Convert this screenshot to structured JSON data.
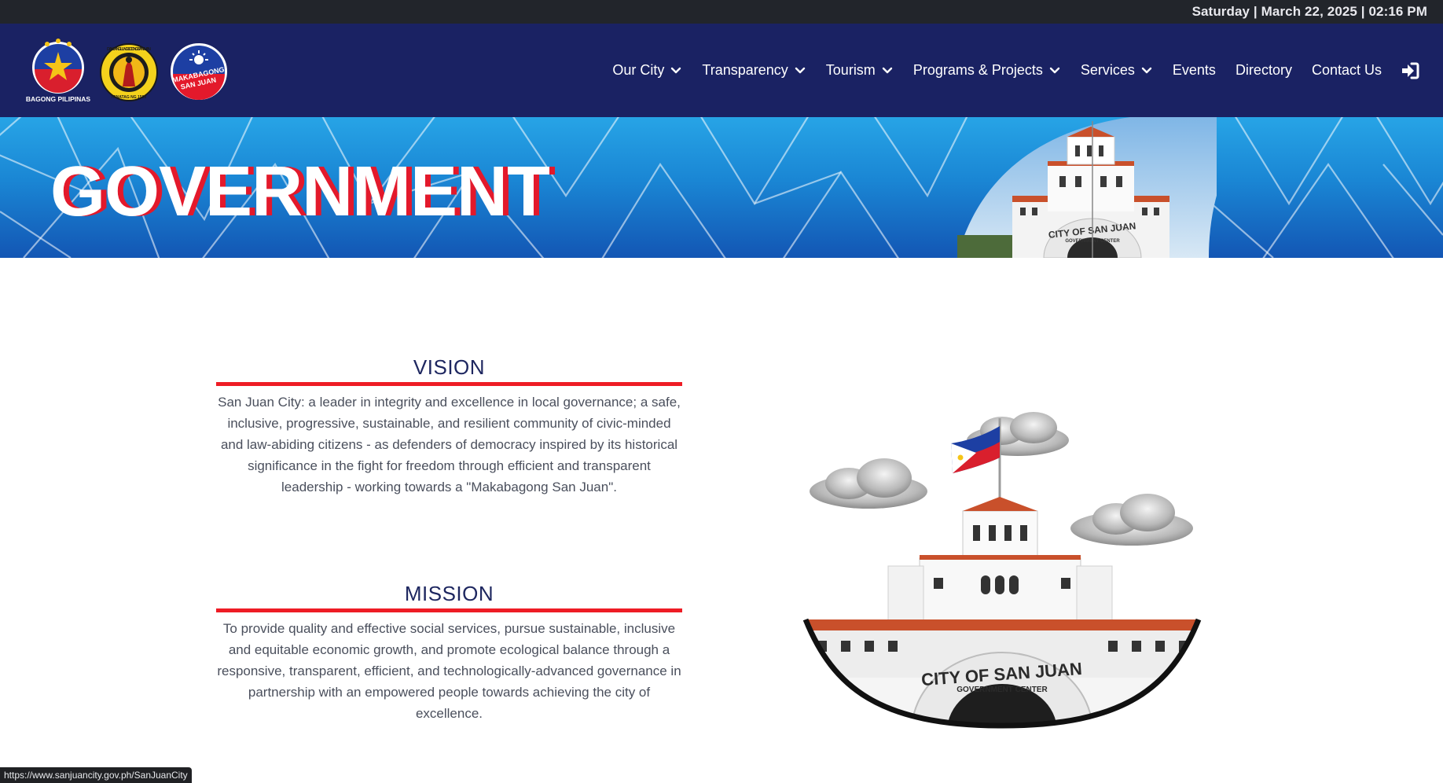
{
  "topbar": {
    "datetime": "Saturday | March 22, 2025 | 02:16 PM"
  },
  "logos": {
    "bagong_pilipinas": "BAGONG PILIPINAS",
    "dakilang_lungsod": "DAKILANG LUNGSOD NG SAN JUAN",
    "dakilang_year": "ITINATAG NG 1590",
    "makabagong_line1": "MAKABAGONG",
    "makabagong_line2": "SAN JUAN"
  },
  "nav": {
    "items": [
      {
        "label": "Our City",
        "has_dropdown": true
      },
      {
        "label": "Transparency",
        "has_dropdown": true
      },
      {
        "label": "Tourism",
        "has_dropdown": true
      },
      {
        "label": "Programs & Projects",
        "has_dropdown": true
      },
      {
        "label": "Services",
        "has_dropdown": true
      },
      {
        "label": "Events",
        "has_dropdown": false
      },
      {
        "label": "Directory",
        "has_dropdown": false
      },
      {
        "label": "Contact Us",
        "has_dropdown": false
      }
    ],
    "login_icon": "sign-in-icon"
  },
  "banner": {
    "title": "GOVERNMENT",
    "building_sign_1": "CITY OF SAN JUAN",
    "building_sign_2": "GOVERNMENT CENTER"
  },
  "vision": {
    "title": "VISION",
    "text": "San Juan City: a leader in integrity and excellence in local governance; a safe, inclusive, progressive, sustainable, and resilient community of civic-minded and law-abiding citizens - as defenders of democracy inspired by its historical significance in the fight for freedom through efficient and transparent leadership - working towards a \"Makabagong San Juan\"."
  },
  "mission": {
    "title": "MISSION",
    "text": "To provide quality and effective social services, pursue sustainable, inclusive and equitable economic growth, and promote ecological balance through a responsive, transparent, efficient, and technologically-advanced governance in partnership with an empowered people towards achieving the city of excellence."
  },
  "illustration": {
    "sign_1": "CITY OF SAN JUAN",
    "sign_2": "GOVERNMENT CENTER"
  },
  "status_bar": {
    "url": "https://www.sanjuancity.gov.ph/SanJuanCity"
  },
  "colors": {
    "navy": "#1a2263",
    "accent_red": "#ee1c25",
    "banner_blue": "#1a86d4",
    "topbar": "#22252b"
  }
}
